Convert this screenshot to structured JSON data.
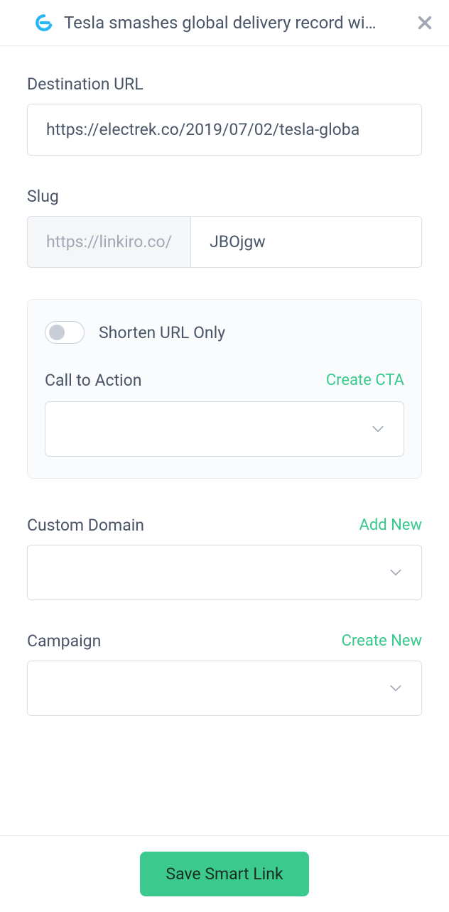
{
  "header": {
    "title": "Tesla smashes global delivery record wi…"
  },
  "destination": {
    "label": "Destination URL",
    "value": "https://electrek.co/2019/07/02/tesla-globa"
  },
  "slug": {
    "label": "Slug",
    "prefix": "https://linkiro.co/",
    "value": "JBOjgw"
  },
  "shorten": {
    "label": "Shorten URL Only"
  },
  "cta": {
    "label": "Call to Action",
    "action": "Create CTA"
  },
  "domain": {
    "label": "Custom Domain",
    "action": "Add New"
  },
  "campaign": {
    "label": "Campaign",
    "action": "Create New"
  },
  "footer": {
    "save_label": "Save Smart Link"
  }
}
